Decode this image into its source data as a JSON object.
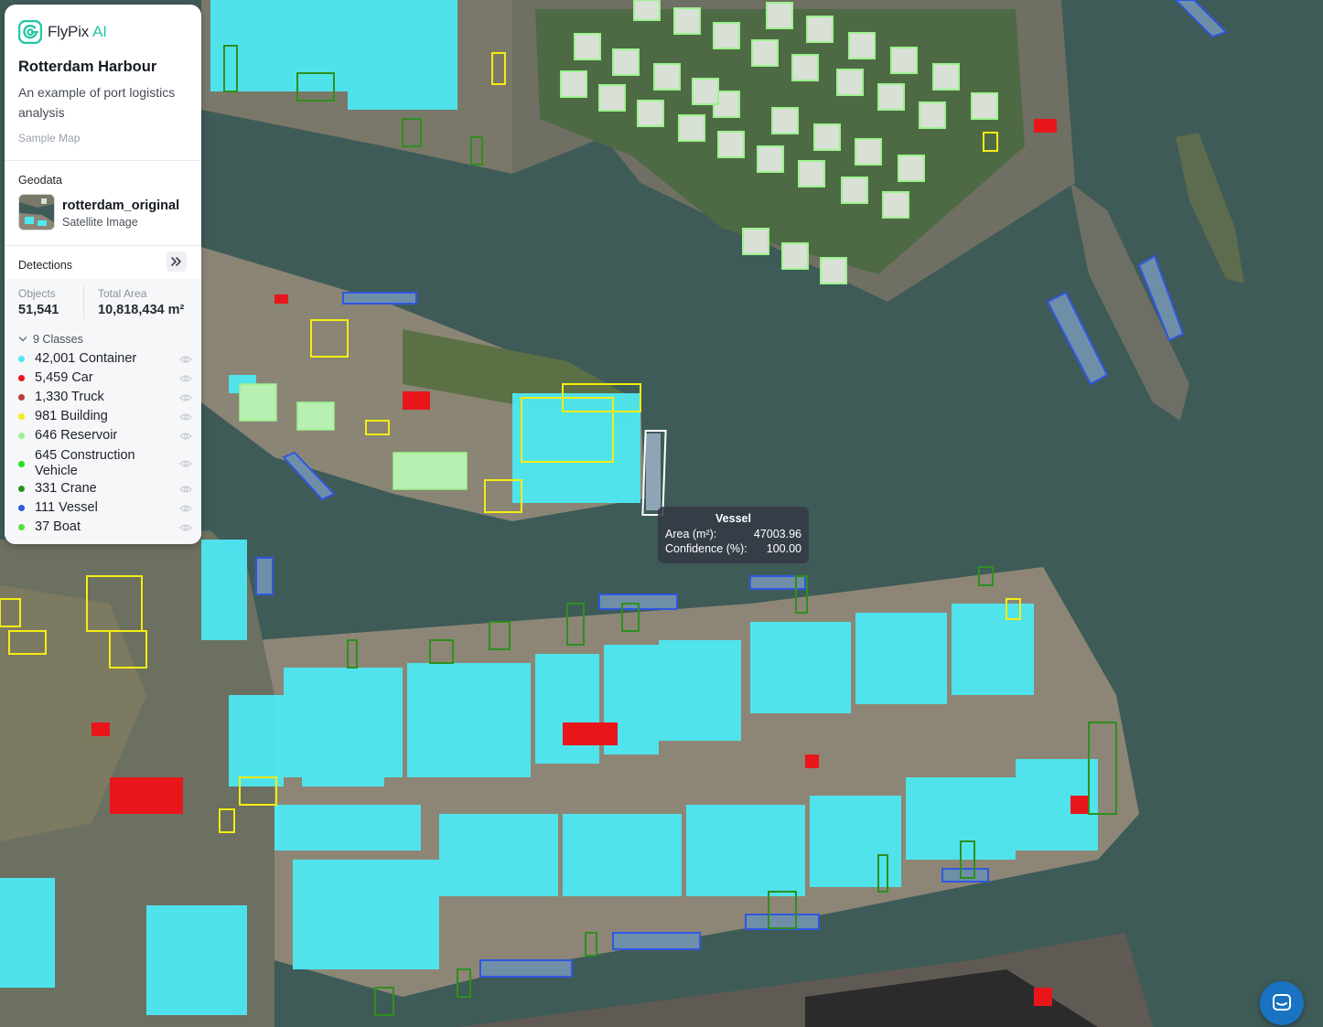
{
  "brand": {
    "name": "FlyPix",
    "suffix": "AI",
    "accent": "#24c6a4",
    "logo_icon": "flypix-logo-icon"
  },
  "project": {
    "title": "Rotterdam Harbour",
    "subtitle": "An example of port logistics analysis",
    "tag": "Sample Map"
  },
  "geodata": {
    "section_label": "Geodata",
    "file_name": "rotterdam_original",
    "file_type": "Satellite Image"
  },
  "detections": {
    "section_label": "Detections",
    "expand_icon": "double-chevron-right-icon",
    "objects_label": "Objects",
    "objects_value": "51,541",
    "area_label": "Total Area",
    "area_value": "10,818,434 m²",
    "classes_label": "9 Classes",
    "classes": [
      {
        "label": "42,001 Container",
        "color": "#4ee8f2"
      },
      {
        "label": "5,459 Car",
        "color": "#e8161b"
      },
      {
        "label": "1,330 Truck",
        "color": "#b83a3a"
      },
      {
        "label": "981 Building",
        "color": "#f5ec13"
      },
      {
        "label": "646 Reservoir",
        "color": "#9df28e"
      },
      {
        "label": "645 Construction Vehicle",
        "color": "#1ee21e"
      },
      {
        "label": "331 Crane",
        "color": "#2e8f1e"
      },
      {
        "label": "111 Vessel",
        "color": "#3057e3"
      },
      {
        "label": "37 Boat",
        "color": "#52e33a"
      }
    ],
    "visibility_icon": "eye-icon"
  },
  "tooltip": {
    "title": "Vessel",
    "area_label": "Area (m²):",
    "area_value": "47003.96",
    "confidence_label": "Confidence (%):",
    "confidence_value": "100.00"
  },
  "chat": {
    "icon": "chat-bubble-icon",
    "color": "#1a72c2"
  }
}
